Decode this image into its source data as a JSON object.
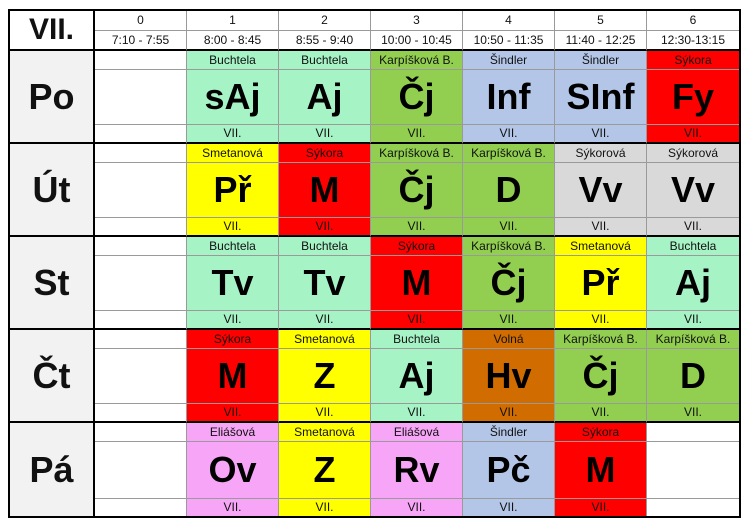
{
  "title": "VII.",
  "periods": [
    {
      "num": "0",
      "time": "7:10 - 7:55"
    },
    {
      "num": "1",
      "time": "8:00 - 8:45"
    },
    {
      "num": "2",
      "time": "8:55 - 9:40"
    },
    {
      "num": "3",
      "time": "10:00 - 10:45"
    },
    {
      "num": "4",
      "time": "10:50 - 11:35"
    },
    {
      "num": "5",
      "time": "11:40 - 12:25"
    },
    {
      "num": "6",
      "time": "12:30-13:15"
    }
  ],
  "colors": {
    "teal": "#a6f3c6",
    "olive": "#92cf50",
    "blue": "#b4c6e7",
    "red": "#ff0000",
    "yellow": "#ffff00",
    "gray": "#d9d9d9",
    "orange": "#d06c00",
    "pink": "#f7a6f7",
    "white": "#ffffff"
  },
  "days": [
    {
      "name": "Po",
      "lessons": [
        null,
        {
          "teacher": "Buchtela",
          "subject": "sAj",
          "class": "VII.",
          "color": "teal"
        },
        {
          "teacher": "Buchtela",
          "subject": "Aj",
          "class": "VII.",
          "color": "teal"
        },
        {
          "teacher": "Karpíšková B.",
          "subject": "Čj",
          "class": "VII.",
          "color": "olive"
        },
        {
          "teacher": "Šindler",
          "subject": "Inf",
          "class": "VII.",
          "color": "blue"
        },
        {
          "teacher": "Šindler",
          "subject": "SInf",
          "class": "VII.",
          "color": "blue"
        },
        {
          "teacher": "Sýkora",
          "subject": "Fy",
          "class": "VII.",
          "color": "red"
        }
      ]
    },
    {
      "name": "Út",
      "lessons": [
        null,
        {
          "teacher": "Smetanová",
          "subject": "Př",
          "class": "VII.",
          "color": "yellow"
        },
        {
          "teacher": "Sýkora",
          "subject": "M",
          "class": "VII.",
          "color": "red"
        },
        {
          "teacher": "Karpíšková B.",
          "subject": "Čj",
          "class": "VII.",
          "color": "olive"
        },
        {
          "teacher": "Karpíšková B.",
          "subject": "D",
          "class": "VII.",
          "color": "olive"
        },
        {
          "teacher": "Sýkorová",
          "subject": "Vv",
          "class": "VII.",
          "color": "gray"
        },
        {
          "teacher": "Sýkorová",
          "subject": "Vv",
          "class": "VII.",
          "color": "gray"
        }
      ]
    },
    {
      "name": "St",
      "lessons": [
        null,
        {
          "teacher": "Buchtela",
          "subject": "Tv",
          "class": "VII.",
          "color": "teal"
        },
        {
          "teacher": "Buchtela",
          "subject": "Tv",
          "class": "VII.",
          "color": "teal"
        },
        {
          "teacher": "Sýkora",
          "subject": "M",
          "class": "VII.",
          "color": "red"
        },
        {
          "teacher": "Karpíšková B.",
          "subject": "Čj",
          "class": "VII.",
          "color": "olive"
        },
        {
          "teacher": "Smetanová",
          "subject": "Př",
          "class": "VII.",
          "color": "yellow"
        },
        {
          "teacher": "Buchtela",
          "subject": "Aj",
          "class": "VII.",
          "color": "teal"
        }
      ]
    },
    {
      "name": "Čt",
      "lessons": [
        null,
        {
          "teacher": "Sýkora",
          "subject": "M",
          "class": "VII.",
          "color": "red"
        },
        {
          "teacher": "Smetanová",
          "subject": "Z",
          "class": "VII.",
          "color": "yellow"
        },
        {
          "teacher": "Buchtela",
          "subject": "Aj",
          "class": "VII.",
          "color": "teal"
        },
        {
          "teacher": "Volná",
          "subject": "Hv",
          "class": "VII.",
          "color": "orange"
        },
        {
          "teacher": "Karpíšková B.",
          "subject": "Čj",
          "class": "VII.",
          "color": "olive"
        },
        {
          "teacher": "Karpíšková B.",
          "subject": "D",
          "class": "VII.",
          "color": "olive"
        }
      ]
    },
    {
      "name": "Pá",
      "lessons": [
        null,
        {
          "teacher": "Eliášová",
          "subject": "Ov",
          "class": "VII.",
          "color": "pink"
        },
        {
          "teacher": "Smetanová",
          "subject": "Z",
          "class": "VII.",
          "color": "yellow"
        },
        {
          "teacher": "Eliášová",
          "subject": "Rv",
          "class": "VII.",
          "color": "pink"
        },
        {
          "teacher": "Šindler",
          "subject": "Pč",
          "class": "VII.",
          "color": "blue"
        },
        {
          "teacher": "Sýkora",
          "subject": "M",
          "class": "VII.",
          "color": "red"
        },
        null
      ]
    }
  ]
}
